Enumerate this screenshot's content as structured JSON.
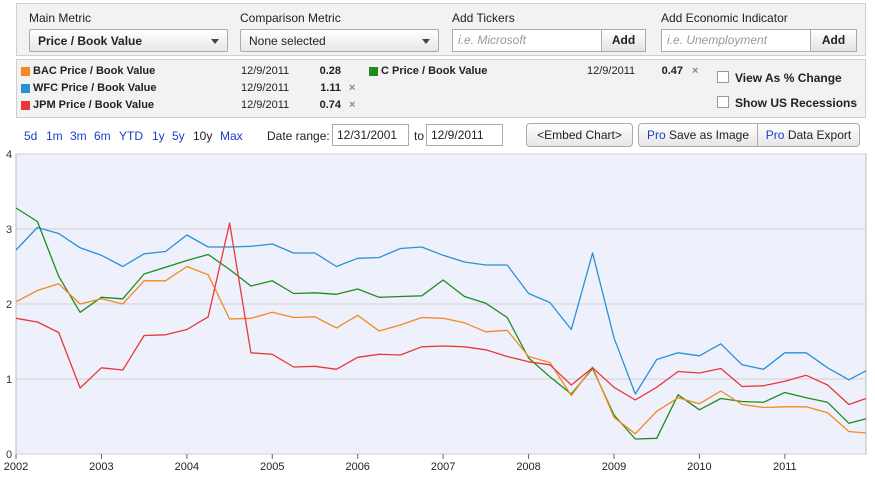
{
  "controls": {
    "main_metric_label": "Main Metric",
    "main_metric_value": "Price / Book Value",
    "comparison_label": "Comparison Metric",
    "comparison_value": "None selected",
    "tickers_label": "Add Tickers",
    "tickers_placeholder": "i.e. Microsoft",
    "tickers_add": "Add",
    "econ_label": "Add Economic Indicator",
    "econ_placeholder": "i.e. Unemployment",
    "econ_add": "Add"
  },
  "series_panel": {
    "rows": [
      {
        "name": "BAC Price / Book Value",
        "date": "12/9/2011",
        "value": "0.28",
        "color": "#f4891f",
        "removable": false
      },
      {
        "name": "WFC Price / Book Value",
        "date": "12/9/2011",
        "value": "1.11",
        "color": "#2a90d8",
        "removable": true
      },
      {
        "name": "JPM Price / Book Value",
        "date": "12/9/2011",
        "value": "0.74",
        "color": "#e8383d",
        "removable": true
      },
      {
        "name": "C Price / Book Value",
        "date": "12/9/2011",
        "value": "0.47",
        "color": "#1f8c1f",
        "removable": true
      }
    ],
    "remove_icon": "×",
    "view_pct_label": "View As % Change",
    "recessions_label": "Show US Recessions"
  },
  "toolbar": {
    "zooms": [
      "5d",
      "1m",
      "3m",
      "6m",
      "YTD",
      "1y",
      "5y",
      "10y",
      "Max"
    ],
    "active_zoom": "10y",
    "date_range_label": "Date range:",
    "date_from": "12/31/2001",
    "to_label": "to",
    "date_to": "12/9/2011",
    "embed_label": "<Embed Chart>",
    "save_pro": "Pro",
    "save_label": "Save as Image",
    "export_pro": "Pro",
    "export_label": "Data Export"
  },
  "chart_data": {
    "type": "line",
    "xlim": [
      2002.0,
      2011.95
    ],
    "ylim": [
      0,
      4
    ],
    "x_ticks": [
      "2002",
      "2003",
      "2004",
      "2005",
      "2006",
      "2007",
      "2008",
      "2009",
      "2010",
      "2011"
    ],
    "y_ticks": [
      "4",
      "3",
      "2",
      "1",
      "0"
    ],
    "grid": true,
    "series": [
      {
        "name": "WFC Price / Book Value",
        "color": "#2a90d8",
        "x": [
          2002.0,
          2002.25,
          2002.5,
          2002.75,
          2003.0,
          2003.25,
          2003.5,
          2003.75,
          2004.0,
          2004.25,
          2004.5,
          2004.75,
          2005.0,
          2005.25,
          2005.5,
          2005.75,
          2006.0,
          2006.25,
          2006.5,
          2006.75,
          2007.0,
          2007.25,
          2007.5,
          2007.75,
          2008.0,
          2008.25,
          2008.5,
          2008.75,
          2009.0,
          2009.25,
          2009.5,
          2009.75,
          2010.0,
          2010.25,
          2010.5,
          2010.75,
          2011.0,
          2011.25,
          2011.5,
          2011.75,
          2011.95
        ],
        "y": [
          2.72,
          3.02,
          2.94,
          2.75,
          2.65,
          2.5,
          2.67,
          2.7,
          2.92,
          2.76,
          2.76,
          2.77,
          2.8,
          2.68,
          2.68,
          2.5,
          2.61,
          2.62,
          2.74,
          2.76,
          2.65,
          2.56,
          2.52,
          2.52,
          2.14,
          2.02,
          1.66,
          2.68,
          1.55,
          0.8,
          1.26,
          1.35,
          1.31,
          1.47,
          1.19,
          1.13,
          1.35,
          1.35,
          1.15,
          0.99,
          1.11
        ]
      },
      {
        "name": "C Price / Book Value",
        "color": "#1f8c1f",
        "x": [
          2002.0,
          2002.25,
          2002.5,
          2002.75,
          2003.0,
          2003.25,
          2003.5,
          2003.75,
          2004.0,
          2004.25,
          2004.5,
          2004.75,
          2005.0,
          2005.25,
          2005.5,
          2005.75,
          2006.0,
          2006.25,
          2006.5,
          2006.75,
          2007.0,
          2007.25,
          2007.5,
          2007.75,
          2008.0,
          2008.25,
          2008.5,
          2008.75,
          2009.0,
          2009.25,
          2009.5,
          2009.75,
          2010.0,
          2010.25,
          2010.5,
          2010.75,
          2011.0,
          2011.25,
          2011.5,
          2011.75,
          2011.95
        ],
        "y": [
          3.28,
          3.1,
          2.37,
          1.89,
          2.09,
          2.07,
          2.4,
          2.49,
          2.58,
          2.66,
          2.46,
          2.24,
          2.31,
          2.14,
          2.15,
          2.13,
          2.2,
          2.09,
          2.1,
          2.11,
          2.32,
          2.1,
          2.01,
          1.82,
          1.28,
          1.03,
          0.8,
          1.14,
          0.52,
          0.2,
          0.21,
          0.79,
          0.59,
          0.74,
          0.7,
          0.69,
          0.82,
          0.75,
          0.69,
          0.41,
          0.47
        ]
      },
      {
        "name": "BAC Price / Book Value",
        "color": "#f4891f",
        "x": [
          2002.0,
          2002.25,
          2002.5,
          2002.75,
          2003.0,
          2003.25,
          2003.5,
          2003.75,
          2004.0,
          2004.25,
          2004.5,
          2004.75,
          2005.0,
          2005.25,
          2005.5,
          2005.75,
          2006.0,
          2006.25,
          2006.5,
          2006.75,
          2007.0,
          2007.25,
          2007.5,
          2007.75,
          2008.0,
          2008.25,
          2008.5,
          2008.75,
          2009.0,
          2009.25,
          2009.5,
          2009.75,
          2010.0,
          2010.25,
          2010.5,
          2010.75,
          2011.0,
          2011.25,
          2011.5,
          2011.75,
          2011.95
        ],
        "y": [
          2.03,
          2.18,
          2.27,
          2.0,
          2.07,
          2.0,
          2.31,
          2.31,
          2.5,
          2.39,
          1.8,
          1.81,
          1.89,
          1.82,
          1.83,
          1.68,
          1.85,
          1.64,
          1.72,
          1.82,
          1.81,
          1.75,
          1.63,
          1.65,
          1.3,
          1.22,
          0.78,
          1.16,
          0.49,
          0.27,
          0.57,
          0.75,
          0.67,
          0.84,
          0.66,
          0.62,
          0.63,
          0.63,
          0.55,
          0.3,
          0.28
        ]
      },
      {
        "name": "JPM Price / Book Value",
        "color": "#e8383d",
        "x": [
          2002.0,
          2002.25,
          2002.5,
          2002.75,
          2003.0,
          2003.25,
          2003.5,
          2003.75,
          2004.0,
          2004.25,
          2004.5,
          2004.75,
          2005.0,
          2005.25,
          2005.5,
          2005.75,
          2006.0,
          2006.25,
          2006.5,
          2006.75,
          2007.0,
          2007.25,
          2007.5,
          2007.75,
          2008.0,
          2008.25,
          2008.5,
          2008.75,
          2009.0,
          2009.25,
          2009.5,
          2009.75,
          2010.0,
          2010.25,
          2010.5,
          2010.75,
          2011.0,
          2011.25,
          2011.5,
          2011.75,
          2011.95
        ],
        "y": [
          1.81,
          1.76,
          1.62,
          0.88,
          1.15,
          1.12,
          1.58,
          1.59,
          1.66,
          1.83,
          3.08,
          1.35,
          1.33,
          1.16,
          1.17,
          1.13,
          1.29,
          1.33,
          1.32,
          1.43,
          1.44,
          1.43,
          1.39,
          1.3,
          1.23,
          1.19,
          0.92,
          1.15,
          0.89,
          0.72,
          0.89,
          1.1,
          1.08,
          1.14,
          0.9,
          0.91,
          0.97,
          1.05,
          0.92,
          0.66,
          0.74
        ]
      }
    ]
  }
}
